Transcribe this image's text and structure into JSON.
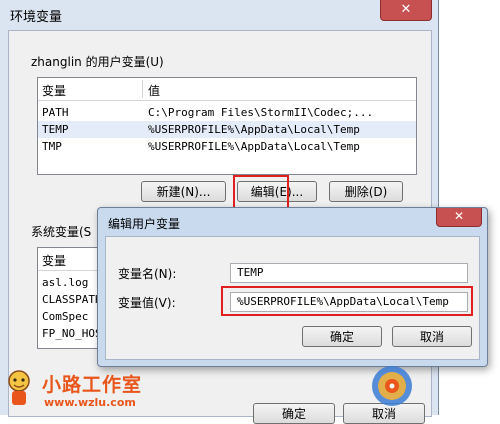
{
  "outer_window": {
    "title": "环境变量",
    "close_glyph": "✕",
    "user_group": {
      "label": "zhanglin 的用户变量(U)",
      "columns": [
        "变量",
        "值"
      ],
      "rows": [
        {
          "name": "PATH",
          "value": "C:\\Program Files\\StormII\\Codec;..."
        },
        {
          "name": "TEMP",
          "value": "%USERPROFILE%\\AppData\\Local\\Temp"
        },
        {
          "name": "TMP",
          "value": "%USERPROFILE%\\AppData\\Local\\Temp"
        }
      ],
      "buttons": {
        "new": "新建(N)...",
        "edit": "编辑(E)...",
        "delete": "删除(D)"
      }
    },
    "system_group": {
      "label": "系统变量(S",
      "columns": [
        "变量"
      ],
      "rows": [
        {
          "name": "asl.log"
        },
        {
          "name": "CLASSPATH"
        },
        {
          "name": "ComSpec"
        },
        {
          "name": "FP_NO_HOST"
        }
      ]
    },
    "buttons": {
      "ok": "确定",
      "cancel": "取消"
    }
  },
  "edit_dialog": {
    "title": "编辑用户变量",
    "close_glyph": "✕",
    "name_label": "变量名(N):",
    "name_value": "TEMP",
    "value_label": "变量值(V):",
    "value_value": "%USERPROFILE%\\AppData\\Local\\Temp",
    "buttons": {
      "ok": "确定",
      "cancel": "取消"
    }
  },
  "watermark": {
    "name": "小路工作室",
    "url": "www.wzlu.com"
  },
  "colors": {
    "highlight_box": "#e02020",
    "watermark": "#e8561b",
    "title_bar": "#dbe5f1",
    "close_button": "#c75050"
  }
}
